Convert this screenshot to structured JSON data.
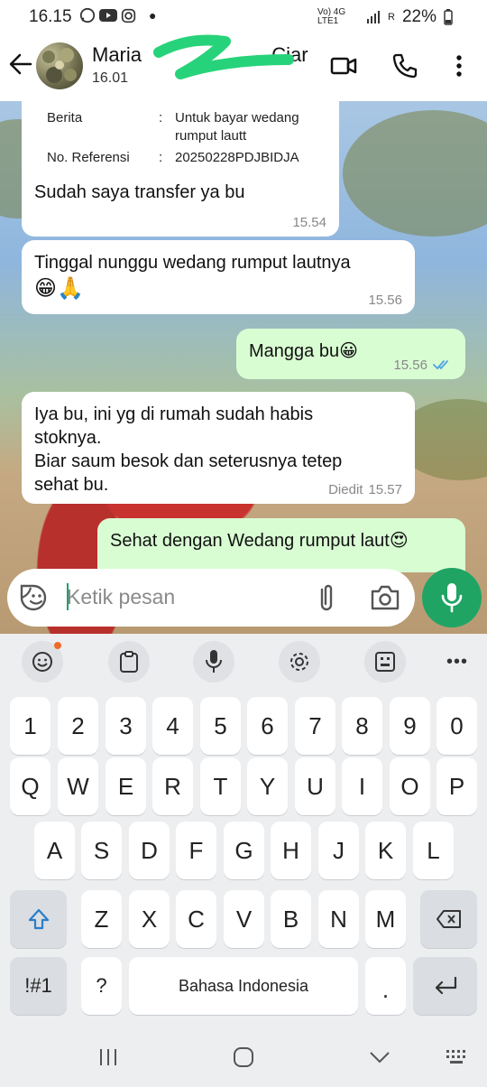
{
  "status": {
    "time": "16.15",
    "network": "Vo) 4G LTE1",
    "signal_extra": "R",
    "battery": "22%"
  },
  "header": {
    "contact_name": "Maria",
    "contact_name_tail": "Ciar",
    "last_seen": "16.01"
  },
  "chat": {
    "transfer_card": {
      "berita_label": "Berita",
      "berita_colon": ":",
      "berita_value_1": "Untuk bayar wedang",
      "berita_value_2": "rumput lautt",
      "ref_label": "No. Referensi",
      "ref_colon": ":",
      "ref_value": "20250228PDJBIDJA",
      "message": "Sudah saya transfer ya bu",
      "time": "15.54"
    },
    "messages": [
      {
        "direction": "in",
        "text_1": "Tinggal nunggu wedang rumput lautnya",
        "text_2": "😁🙏",
        "time": "15.56"
      },
      {
        "direction": "out",
        "text_1": "Mangga bu😀",
        "time": "15.56",
        "read": true
      },
      {
        "direction": "in",
        "text_1": "Iya bu, ini yg di rumah sudah habis",
        "text_2": "stoknya.",
        "text_3": "Biar saum besok dan seterusnya tetep",
        "text_4": "sehat bu.",
        "edited": "Diedit",
        "time": "15.57"
      },
      {
        "direction": "out",
        "text_1": "Sehat dengan Wedang rumput laut😍"
      }
    ]
  },
  "input": {
    "placeholder": "Ketik pesan"
  },
  "keyboard": {
    "row_numbers": [
      "1",
      "2",
      "3",
      "4",
      "5",
      "6",
      "7",
      "8",
      "9",
      "0"
    ],
    "row_1": [
      "Q",
      "W",
      "E",
      "R",
      "T",
      "Y",
      "U",
      "I",
      "O",
      "P"
    ],
    "row_2": [
      "A",
      "S",
      "D",
      "F",
      "G",
      "H",
      "J",
      "K",
      "L"
    ],
    "row_3": [
      "Z",
      "X",
      "C",
      "V",
      "B",
      "N",
      "M"
    ],
    "symbols_key": "!#1",
    "question_key": "?",
    "space_label": "Bahasa Indonesia",
    "period_key": "."
  },
  "colors": {
    "accent_green": "#20a464",
    "outgoing_bubble": "#d9fdd3",
    "read_tick": "#4fa3e3"
  }
}
